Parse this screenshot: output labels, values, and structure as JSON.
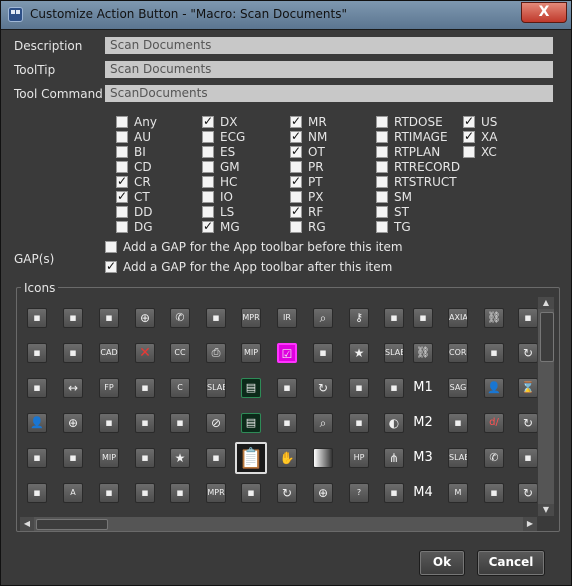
{
  "window": {
    "title": "Customize Action Button - \"Macro: Scan Documents\"",
    "close_glyph": "X"
  },
  "form": {
    "description_label": "Description",
    "description_value": "Scan Documents",
    "tooltip_label": "ToolTip",
    "tooltip_value": "Scan Documents",
    "command_label": "Tool Command",
    "command_value": "ScanDocuments"
  },
  "modalities": [
    {
      "label": "Any",
      "checked": false
    },
    {
      "label": "AU",
      "checked": false
    },
    {
      "label": "BI",
      "checked": false
    },
    {
      "label": "CD",
      "checked": false
    },
    {
      "label": "CR",
      "checked": true
    },
    {
      "label": "CT",
      "checked": true
    },
    {
      "label": "DD",
      "checked": false
    },
    {
      "label": "DG",
      "checked": false
    },
    {
      "label": "DX",
      "checked": true
    },
    {
      "label": "ECG",
      "checked": false
    },
    {
      "label": "ES",
      "checked": false
    },
    {
      "label": "GM",
      "checked": false
    },
    {
      "label": "HC",
      "checked": false
    },
    {
      "label": "IO",
      "checked": false
    },
    {
      "label": "LS",
      "checked": false
    },
    {
      "label": "MG",
      "checked": true
    },
    {
      "label": "MR",
      "checked": true
    },
    {
      "label": "NM",
      "checked": true
    },
    {
      "label": "OT",
      "checked": true
    },
    {
      "label": "PR",
      "checked": false
    },
    {
      "label": "PT",
      "checked": true
    },
    {
      "label": "PX",
      "checked": false
    },
    {
      "label": "RF",
      "checked": true
    },
    {
      "label": "RG",
      "checked": false
    },
    {
      "label": "RTDOSE",
      "checked": false
    },
    {
      "label": "RTIMAGE",
      "checked": false
    },
    {
      "label": "RTPLAN",
      "checked": false
    },
    {
      "label": "RTRECORD",
      "checked": false
    },
    {
      "label": "RTSTRUCT",
      "checked": false
    },
    {
      "label": "SM",
      "checked": false
    },
    {
      "label": "ST",
      "checked": false
    },
    {
      "label": "TG",
      "checked": false
    },
    {
      "label": "US",
      "checked": true
    },
    {
      "label": "XA",
      "checked": true
    },
    {
      "label": "XC",
      "checked": false
    }
  ],
  "gap": {
    "label": "GAP(s)",
    "before_label": "Add a GAP for the App toolbar before this item",
    "before_checked": false,
    "after_label": "Add a GAP for the App toolbar after this item",
    "after_checked": true
  },
  "icons": {
    "group_label": "Icons",
    "rows": [
      [
        "pointer-icon",
        "layers-icon",
        "binoculars-icon",
        "crosshair-icon",
        "phone-icon",
        "frame-icon",
        "MPR",
        "IR",
        "magnifier-icon",
        "key-icon",
        "lamp-icon",
        "ruler-icon",
        "AXIAL",
        "link-icon",
        "loop-icon"
      ],
      [
        "puzzle-icon",
        "text-pointer-icon",
        "CAD",
        "red-x-icon",
        "CC",
        "printer-icon",
        "MIP",
        "magenta-check-icon",
        "font-icon",
        "star-icon",
        "SLAB",
        "chain-icon",
        "CORNL",
        "stripes-icon",
        "rotate-icon"
      ],
      [
        "puzzle-x-icon",
        "double-arrow-icon",
        "FP",
        "ladder-icon",
        "C",
        "SLAB",
        "green-clipboard-icon",
        "wings-icon",
        "redo-icon",
        "picture-icon",
        "bar-icon",
        "M1",
        "SAG",
        "person-icon",
        "hourglass-icon"
      ],
      [
        "person-chat-icon",
        "target-icon",
        "cube-icon",
        "ladder2-icon",
        "tree-icon",
        "no-sign-icon",
        "green-paste-icon",
        "pages-icon",
        "zoom-icon",
        "stand-icon",
        "contrast-icon",
        "M2",
        "snail-icon",
        "red-da-icon",
        "circle-icon"
      ],
      [
        "angle-icon",
        "arrow-box-icon",
        "MIP",
        "film-reel-icon",
        "star-badge-icon",
        "camera-icon",
        "selected-clipboard-icon",
        "hand-icon",
        "gradient-icon",
        "HP",
        "share-icon",
        "M3",
        "SLAB",
        "phone2-icon",
        "timer-icon"
      ],
      [
        "id-card-icon",
        "A",
        "filmstrip-icon",
        "reel2-icon",
        "frame2-icon",
        "MPR",
        "tree2-icon",
        "redo2-icon",
        "reticle-icon",
        "?",
        "double-box-icon",
        "M4",
        "M",
        "badge-icon",
        "circle2-icon"
      ]
    ]
  },
  "buttons": {
    "ok": "Ok",
    "cancel": "Cancel"
  },
  "colors": {
    "dialog_bg": "#3a3a3a",
    "field_bg": "#c8c8c8",
    "close_red": "#c0392b",
    "selected_magenta": "#e000e0"
  }
}
